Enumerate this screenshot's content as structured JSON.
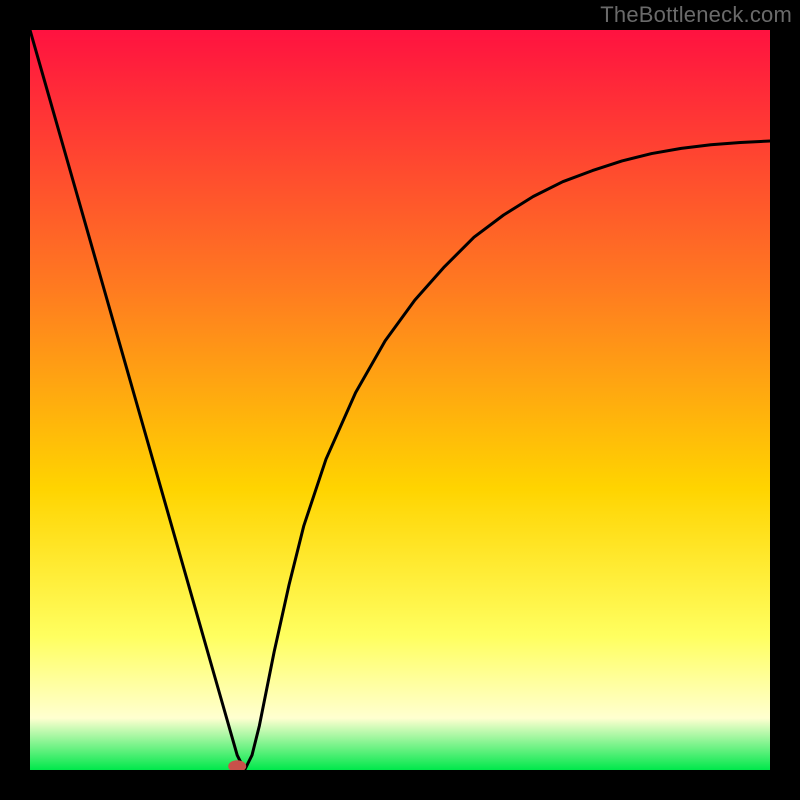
{
  "watermark": "TheBottleneck.com",
  "colors": {
    "black": "#000000",
    "gradient_top": "#ff1240",
    "gradient_mid1": "#ff7b20",
    "gradient_mid2": "#ffd400",
    "gradient_bot1": "#ffff60",
    "gradient_bot2": "#ffffd0",
    "gradient_green": "#00e84b",
    "curve": "#000000",
    "marker": "#c9514a"
  },
  "chart_data": {
    "type": "line",
    "title": "",
    "xlabel": "",
    "ylabel": "",
    "xlim": [
      0,
      100
    ],
    "ylim": [
      0,
      100
    ],
    "x": [
      0,
      2,
      4,
      6,
      8,
      10,
      12,
      14,
      16,
      18,
      20,
      22,
      23,
      24,
      25,
      26,
      27,
      28,
      29,
      30,
      31,
      32,
      33,
      35,
      37,
      40,
      44,
      48,
      52,
      56,
      60,
      64,
      68,
      72,
      76,
      80,
      84,
      88,
      92,
      96,
      100
    ],
    "values": [
      100,
      93,
      86,
      79,
      72,
      65,
      58,
      51,
      44,
      37,
      30,
      23,
      19.5,
      16,
      12.5,
      9,
      5.5,
      2,
      0,
      2,
      6,
      11,
      16,
      25,
      33,
      42,
      51,
      58,
      63.5,
      68,
      72,
      75,
      77.5,
      79.5,
      81,
      82.3,
      83.3,
      84,
      84.5,
      84.8,
      85
    ],
    "marker": {
      "x": 28,
      "y": 0.5
    }
  }
}
